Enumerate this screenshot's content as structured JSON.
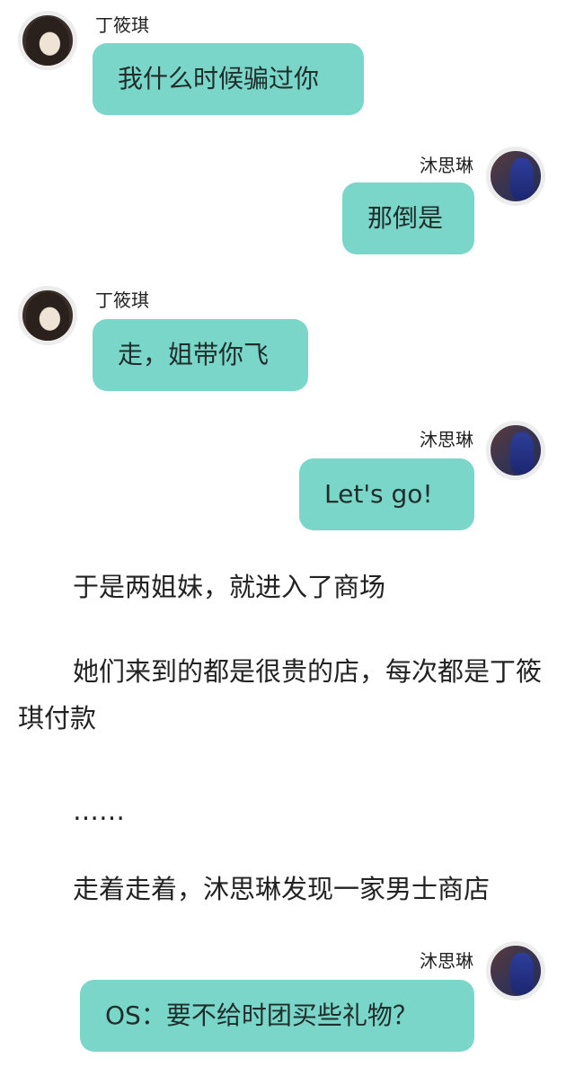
{
  "messages": [
    {
      "sender": "丁筱琪",
      "side": "left",
      "text": "我什么时候骗过你",
      "avatar_icon": "girl-portrait-avatar"
    },
    {
      "sender": "沐思琳",
      "side": "right",
      "text": "那倒是",
      "avatar_icon": "blue-figure-avatar"
    },
    {
      "sender": "丁筱琪",
      "side": "left",
      "text": "走，姐带你飞",
      "avatar_icon": "girl-portrait-avatar"
    },
    {
      "sender": "沐思琳",
      "side": "right",
      "text": "Let's go!",
      "avatar_icon": "blue-figure-avatar"
    }
  ],
  "narration": [
    "于是两姐妹，就进入了商场",
    "她们来到的都是很贵的店，每次都是丁筱琪付款",
    "……",
    "走着走着，沐思琳发现一家男士商店"
  ],
  "last_message": {
    "sender": "沐思琳",
    "side": "right",
    "text": "OS：要不给时团买些礼物？",
    "avatar_icon": "blue-figure-avatar"
  },
  "colors": {
    "bubble": "#7ad6c9",
    "background": "#ffffff",
    "text": "#222222"
  }
}
